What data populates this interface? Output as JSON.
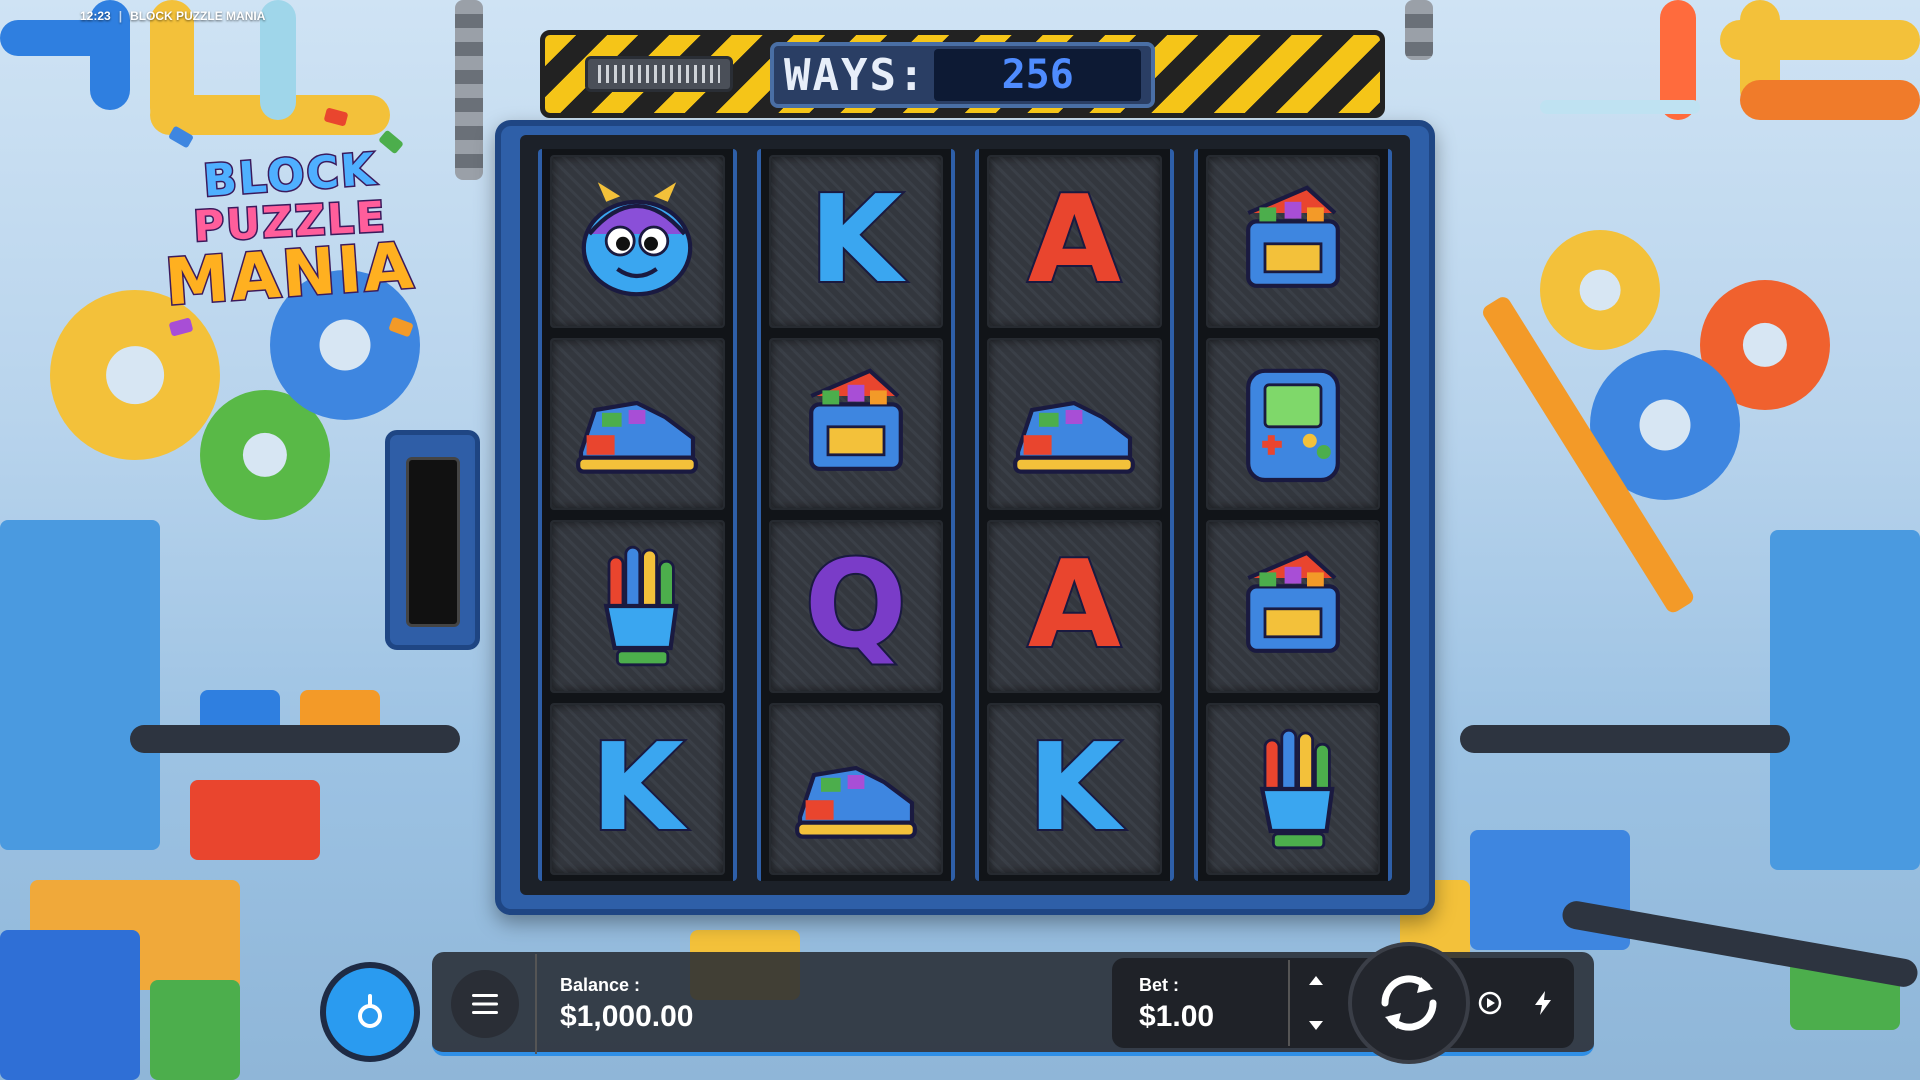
{
  "status_bar": {
    "time": "12:23",
    "separator": "|",
    "game_title": "BLOCK PUZZLE MANIA"
  },
  "logo": {
    "line1": "BLOCK",
    "line2": "PUZZLE",
    "line3": "MANIA"
  },
  "ways": {
    "label": "WAYS:",
    "value": "256"
  },
  "reels": [
    {
      "symbols": [
        "monster",
        "K",
        "A",
        "toolbox"
      ]
    },
    {
      "symbols": [
        "sneaker",
        "toolbox",
        "sneaker",
        "game-console"
      ]
    },
    {
      "symbols": [
        "glove",
        "Q",
        "A",
        "toolbox"
      ]
    },
    {
      "symbols": [
        "K",
        "sneaker",
        "K",
        "glove"
      ]
    }
  ],
  "grid_rows": [
    [
      "monster",
      "K",
      "A",
      "toolbox"
    ],
    [
      "sneaker",
      "toolbox",
      "sneaker",
      "game-console"
    ],
    [
      "glove",
      "Q",
      "A",
      "toolbox"
    ],
    [
      "K",
      "sneaker",
      "K",
      "glove"
    ]
  ],
  "balance": {
    "label": "Balance :",
    "value": "$1,000.00"
  },
  "bet": {
    "label": "Bet :",
    "value": "$1.00"
  },
  "colors": {
    "accent": "#2f8fe6",
    "frame": "#2e5fa8",
    "hazard_yellow": "#f5c518"
  },
  "icons": {
    "menu": "hamburger-icon",
    "provider": "provider-logo-icon",
    "bet_up": "chevron-up-icon",
    "bet_down": "chevron-down-icon",
    "spin": "refresh-icon",
    "autoplay": "autoplay-icon",
    "turbo": "lightning-icon"
  }
}
